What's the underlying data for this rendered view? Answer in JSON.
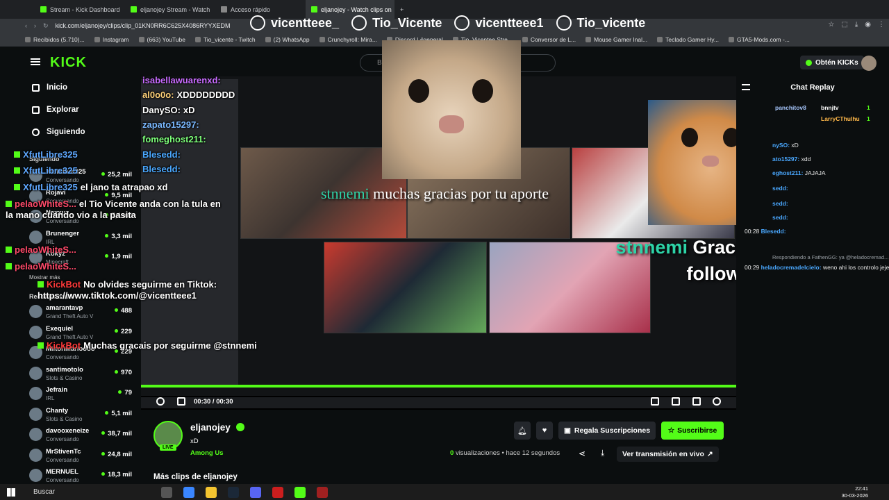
{
  "tabs": [
    {
      "label": "Stream - Kick Dashboard",
      "active": false
    },
    {
      "label": "eljanojey Stream - Watch",
      "active": false
    },
    {
      "label": "Acceso rápido",
      "active": false
    },
    {
      "label": "eljanojey - Watch clips on",
      "active": true
    }
  ],
  "address": "kick.com/eljanojey/clips/clip_01KN0RR6C625X4086RYYXEDM",
  "bookmarks": [
    "Recibidos (5.710)...",
    "Instagram",
    "(663) YouTube",
    "Tio_vicente - Twitch",
    "(2) WhatsApp",
    "Crunchyroll: Mira...",
    "Discord | #general",
    "Tio_Vicentee Stre...",
    "Conversor de L...",
    "Mouse Gamer Inal...",
    "Teclado Gamer Hy...",
    "GTA5-Mods.com -..."
  ],
  "socials": [
    {
      "icon": "instagram-icon",
      "label": "vicentteee_"
    },
    {
      "icon": "youtube-icon",
      "label": "Tio_Vicente"
    },
    {
      "icon": "tiktok-icon",
      "label": "vicentteee1"
    },
    {
      "icon": "twitch-icon",
      "label": "Tio_vicente"
    }
  ],
  "kick": {
    "logo": "KICK",
    "search_placeholder": "Bu",
    "kicks_button": "Obtén KICKs"
  },
  "sidebar": {
    "nav": [
      "Inicio",
      "Explorar",
      "Siguiendo"
    ],
    "following_header": "Siguiendo",
    "recommended_header": "Recomendado",
    "show_more": "Mostrar más",
    "following": [
      {
        "name": "XfutLibre325",
        "category": "Conversando",
        "viewers": "25,2 mil"
      },
      {
        "name": "Rojavi",
        "category": "Conversando",
        "viewers": "9,5 mil"
      },
      {
        "name": "Nexxuz",
        "category": "Conversando",
        "viewers": "7,4 mil"
      },
      {
        "name": "Brunenger",
        "category": "IRL",
        "viewers": "3,3 mil"
      },
      {
        "name": "Kokyz",
        "category": "Minecraft",
        "viewers": "1,9 mil"
      }
    ],
    "recommended": [
      {
        "name": "amarantavp",
        "category": "Grand Theft Auto V",
        "viewers": "488"
      },
      {
        "name": "Exequiel",
        "category": "Grand Theft Auto V",
        "viewers": "229"
      },
      {
        "name": "MiltonMarioooo",
        "category": "Conversando",
        "viewers": "229"
      },
      {
        "name": "santimotolo",
        "category": "Slots & Casino",
        "viewers": "970"
      },
      {
        "name": "Jefrain",
        "category": "IRL",
        "viewers": "79"
      },
      {
        "name": "Chanty",
        "category": "Slots & Casino",
        "viewers": "5,1 mil"
      },
      {
        "name": "davooxeneize",
        "category": "Conversando",
        "viewers": "38,7 mil"
      },
      {
        "name": "MrStivenTc",
        "category": "Conversando",
        "viewers": "24,8 mil"
      },
      {
        "name": "MERNUEL",
        "category": "Conversando",
        "viewers": "18,3 mil"
      }
    ]
  },
  "overlay_chat": [
    {
      "user": "isabellawuarenxd:",
      "text": "",
      "color": "#c86bff"
    },
    {
      "user": "al0o0o:",
      "text": "XDDDDDDDD",
      "color": "#ffd27a"
    },
    {
      "user": "DanySO:",
      "text": "xD",
      "color": "#ffffff"
    },
    {
      "user": "zapato15297:",
      "text": "",
      "color": "#7ab8ff"
    },
    {
      "user": "fomeghost211:",
      "text": "",
      "color": "#7dff7a"
    },
    {
      "user": "Blesedd:",
      "text": "",
      "color": "#4aa8ff"
    },
    {
      "user": "Blesedd:",
      "text": "",
      "color": "#4aa8ff"
    }
  ],
  "overlay_chat_lower": [
    {
      "user": "XfutLibre325",
      "text": "",
      "color": "#5fa8ff"
    },
    {
      "user": "XfutLibre325",
      "text": "",
      "color": "#5fa8ff"
    },
    {
      "user": "XfutLibre325",
      "text": "el jano ta atrapao xd",
      "color": "#5fa8ff"
    },
    {
      "user": "pelaoWhiteS...",
      "text": "el Tio Vicente anda con la tula en la mano cuando vio a la pasita",
      "color": "#ff4a6a"
    },
    {
      "user": "pelaoWhiteS...",
      "text": "",
      "color": "#ff4a6a"
    },
    {
      "user": "pelaoWhiteS...",
      "text": "",
      "color": "#ff4a6a"
    },
    {
      "user": "KickBot",
      "text": "No olvides seguirme en Tiktok: https://www.tiktok.com/@vicentteee1",
      "color": "#ff3a3a"
    },
    {
      "user": "KickBot",
      "text": "Muchas gracais por seguirme @stnnemi",
      "color": "#ff3a3a"
    }
  ],
  "alerts": {
    "donation_user": "stnnemi",
    "donation_text": "muchas gracias por tu aporte",
    "follow_user": "stnnemi",
    "follow_text": "Gracias por el follow!"
  },
  "player": {
    "time": "00:30 / 00:30",
    "progress": 1.0
  },
  "chat_replay": {
    "title": "Chat Replay",
    "leaderboard": [
      {
        "name": "panchitov8",
        "value": ""
      },
      {
        "name": "bnnjtv",
        "value": "1"
      },
      {
        "name": "LarryCThulhu",
        "value": "1"
      }
    ],
    "messages": [
      {
        "time": "",
        "user": "nySO:",
        "text": "xD"
      },
      {
        "time": "",
        "user": "ato15297:",
        "text": "xdd"
      },
      {
        "time": "",
        "user": "eghost211:",
        "text": "JAJAJA"
      },
      {
        "time": "",
        "user": "sedd:",
        "text": ""
      },
      {
        "time": "",
        "user": "sedd:",
        "text": ""
      },
      {
        "time": "",
        "user": "sedd:",
        "text": ""
      },
      {
        "time": "00:28",
        "user": "Blesedd:",
        "text": ""
      },
      {
        "time": "",
        "user": "",
        "text": "Respondiendo a FathenGG: ya @heladocremad..."
      },
      {
        "time": "00:29",
        "user": "heladocremadelcielo:",
        "text": "weno ahi los controlo jeje"
      }
    ]
  },
  "channel": {
    "name": "eljanojey",
    "live": "LIVE",
    "title": "xD",
    "category": "Among Us",
    "gift_label": "Regala Suscripciones",
    "subscribe_label": "Suscribirse",
    "views": "0",
    "views_label": "visualizaciones",
    "age": "hace 12 segundos",
    "live_link": "Ver transmisión en vivo",
    "more_clips": "Más clips de eljanojey"
  },
  "taskbar": {
    "search": "Buscar",
    "time": "22:41",
    "date": "30-03-2026"
  },
  "colors": {
    "kick_green": "#53fc18",
    "bg": "#0b0e0f"
  }
}
